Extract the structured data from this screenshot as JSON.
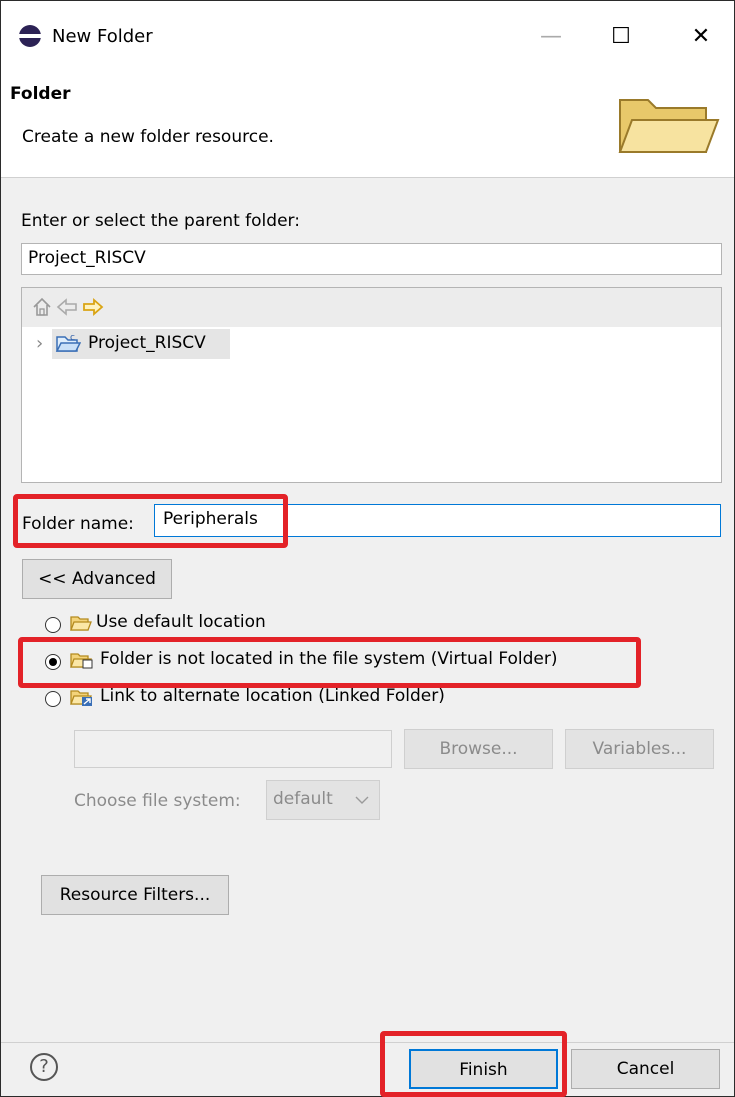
{
  "window": {
    "title": "New Folder",
    "minimize": "—",
    "maximize": "☐",
    "close": "✕"
  },
  "header": {
    "title": "Folder",
    "description": "Create a new folder resource."
  },
  "parent": {
    "label": "Enter or select the parent folder:",
    "value": "Project_RISCV",
    "tree_items": [
      {
        "label": "Project_RISCV",
        "expander": "›"
      }
    ]
  },
  "folder_name": {
    "label": "Folder name:",
    "value": "Peripherals"
  },
  "advanced_button": "<< Advanced",
  "location_options": [
    {
      "label": "Use default location",
      "checked": false
    },
    {
      "label": "Folder is not located in the file system (Virtual Folder)",
      "checked": true
    },
    {
      "label": "Link to alternate location (Linked Folder)",
      "checked": false
    }
  ],
  "linked": {
    "browse": "Browse...",
    "variables": "Variables...",
    "choose_fs_label": "Choose file system:",
    "fs_value": "default"
  },
  "resource_filters": "Resource Filters...",
  "footer": {
    "help": "?",
    "finish": "Finish",
    "cancel": "Cancel"
  },
  "colors": {
    "highlight": "#e32228",
    "accent": "#0078d7"
  }
}
